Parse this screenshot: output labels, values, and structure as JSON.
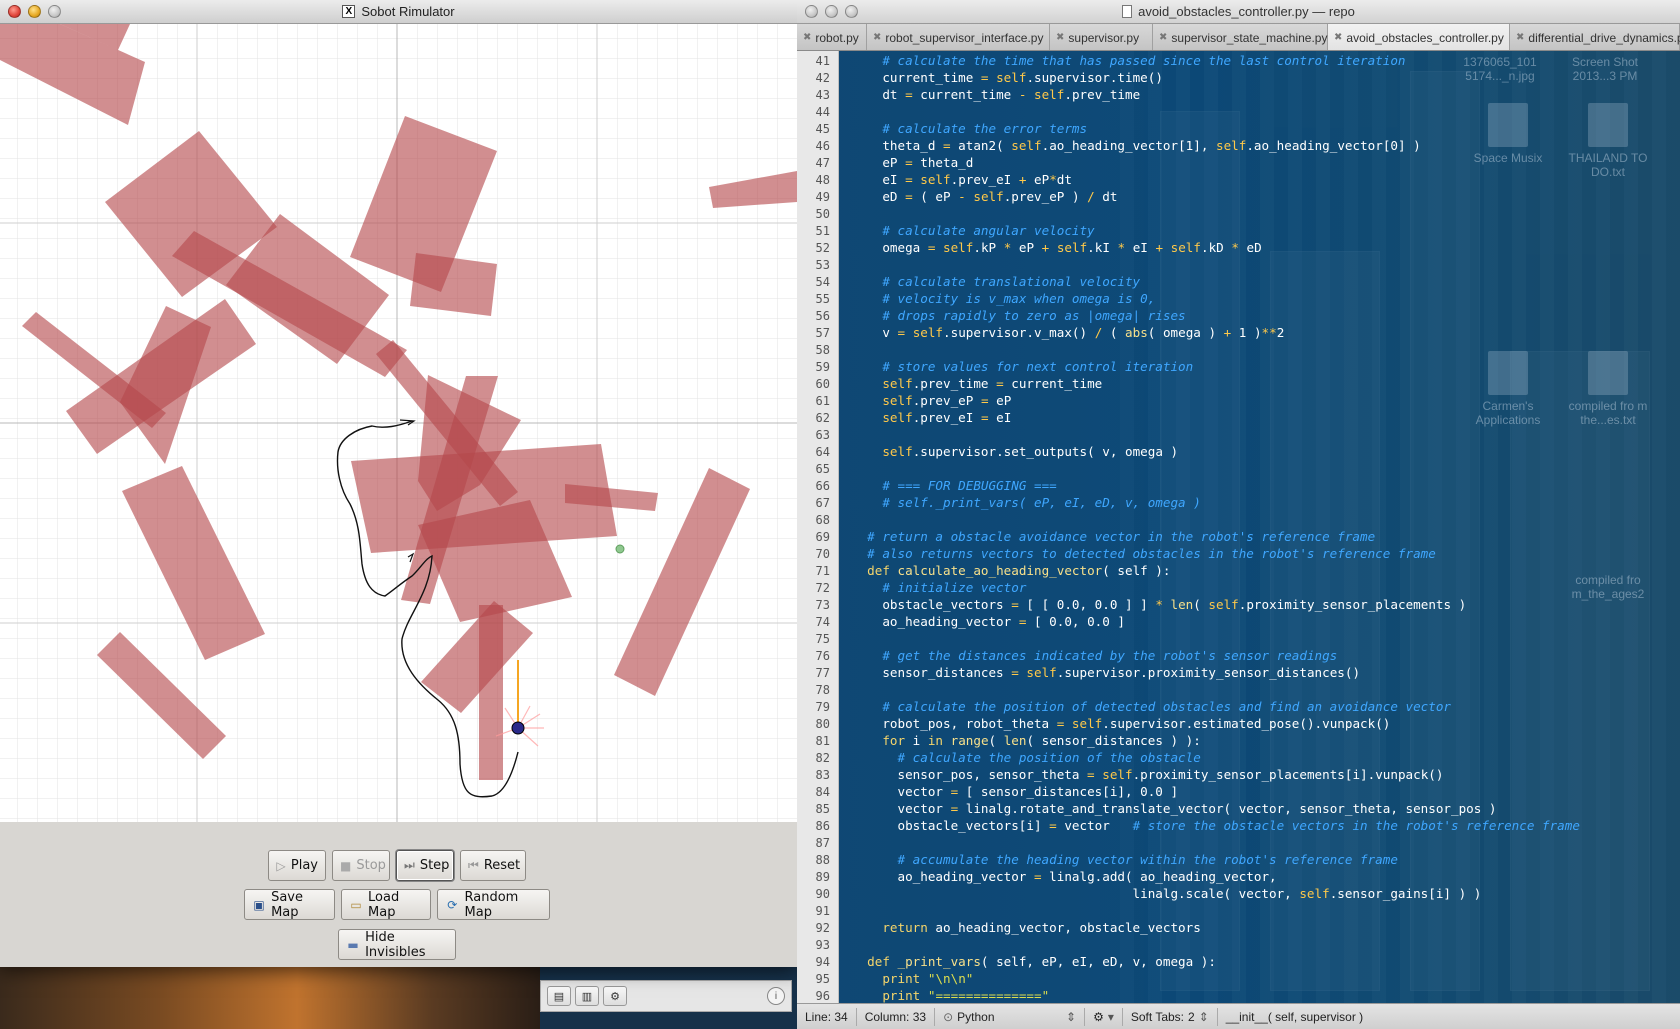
{
  "simulator": {
    "title": "Sobot Rimulator",
    "x11_glyph": "X",
    "buttons": {
      "play": "Play",
      "stop": "Stop",
      "step": "Step",
      "reset": "Reset",
      "save_map": "Save Map",
      "load_map": "Load Map",
      "random_map": "Random Map",
      "hide_invisibles": "Hide Invisibles"
    }
  },
  "editor": {
    "title": "avoid_obstacles_controller.py — repo",
    "tabs": [
      {
        "label": "robot.py"
      },
      {
        "label": "robot_supervisor_interface.py"
      },
      {
        "label": "supervisor.py"
      },
      {
        "label": "supervisor_state_machine.py"
      },
      {
        "label": "avoid_obstacles_controller.py"
      },
      {
        "label": "differential_drive_dynamics.py"
      }
    ],
    "status": {
      "line": "Line: 34",
      "column": "Column: 33",
      "language": "Python",
      "soft_tabs": "Soft Tabs:",
      "tab_size": "2",
      "symbol": "__init__( self, supervisor )"
    },
    "desktop_icons": [
      {
        "label": "1376065_101 5174..._n.jpg"
      },
      {
        "label": "Screen Shot 2013...3 PM"
      },
      {
        "label": "Space Musix"
      },
      {
        "label": "THAILAND TO DO.txt"
      },
      {
        "label": "Carmen's Applications"
      },
      {
        "label": "compiled fro m the...es.txt"
      },
      {
        "label": "compiled fro m_the_ages2"
      }
    ]
  },
  "colors": {
    "obstacle": "#b4484c",
    "path": "#111111",
    "robot": "#2a2a8a",
    "goal": "#8fc88f",
    "heading": "#f5a623",
    "editor_bg": "#0f4773",
    "comment": "#3fa7ff"
  }
}
